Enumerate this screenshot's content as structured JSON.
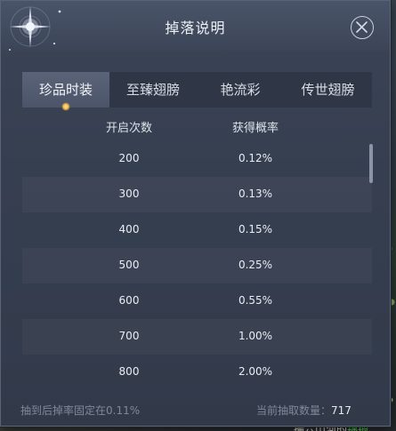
{
  "dialog": {
    "title": "掉落说明",
    "close_icon": "close-icon"
  },
  "tabs": [
    {
      "label": "珍品时装",
      "active": true
    },
    {
      "label": "至臻翅膀",
      "active": false
    },
    {
      "label": "艳流彩",
      "active": false
    },
    {
      "label": "传世翅膀",
      "active": false
    }
  ],
  "table": {
    "headers": [
      "开启次数",
      "获得概率"
    ],
    "rows": [
      {
        "count": "200",
        "rate": "0.12%"
      },
      {
        "count": "300",
        "rate": "0.13%"
      },
      {
        "count": "400",
        "rate": "0.15%"
      },
      {
        "count": "500",
        "rate": "0.25%"
      },
      {
        "count": "600",
        "rate": "0.55%"
      },
      {
        "count": "700",
        "rate": "1.00%"
      },
      {
        "count": "800",
        "rate": "2.00%"
      }
    ]
  },
  "footer": {
    "note": "抽到后掉率固定在0.11%",
    "count_label": "当前抽取数量：",
    "count_value": "717"
  },
  "background": {
    "scroll_text_prefix": "撮六山河的",
    "scroll_text_highlight": "锦锻",
    "scroll_text_suffix": "…",
    "highlight_color": "#4de04d"
  },
  "colors": {
    "dialog_bg": "#363f50",
    "tab_active": "#525b70",
    "text_primary": "#e9edf3",
    "text_muted": "#7f889a"
  }
}
